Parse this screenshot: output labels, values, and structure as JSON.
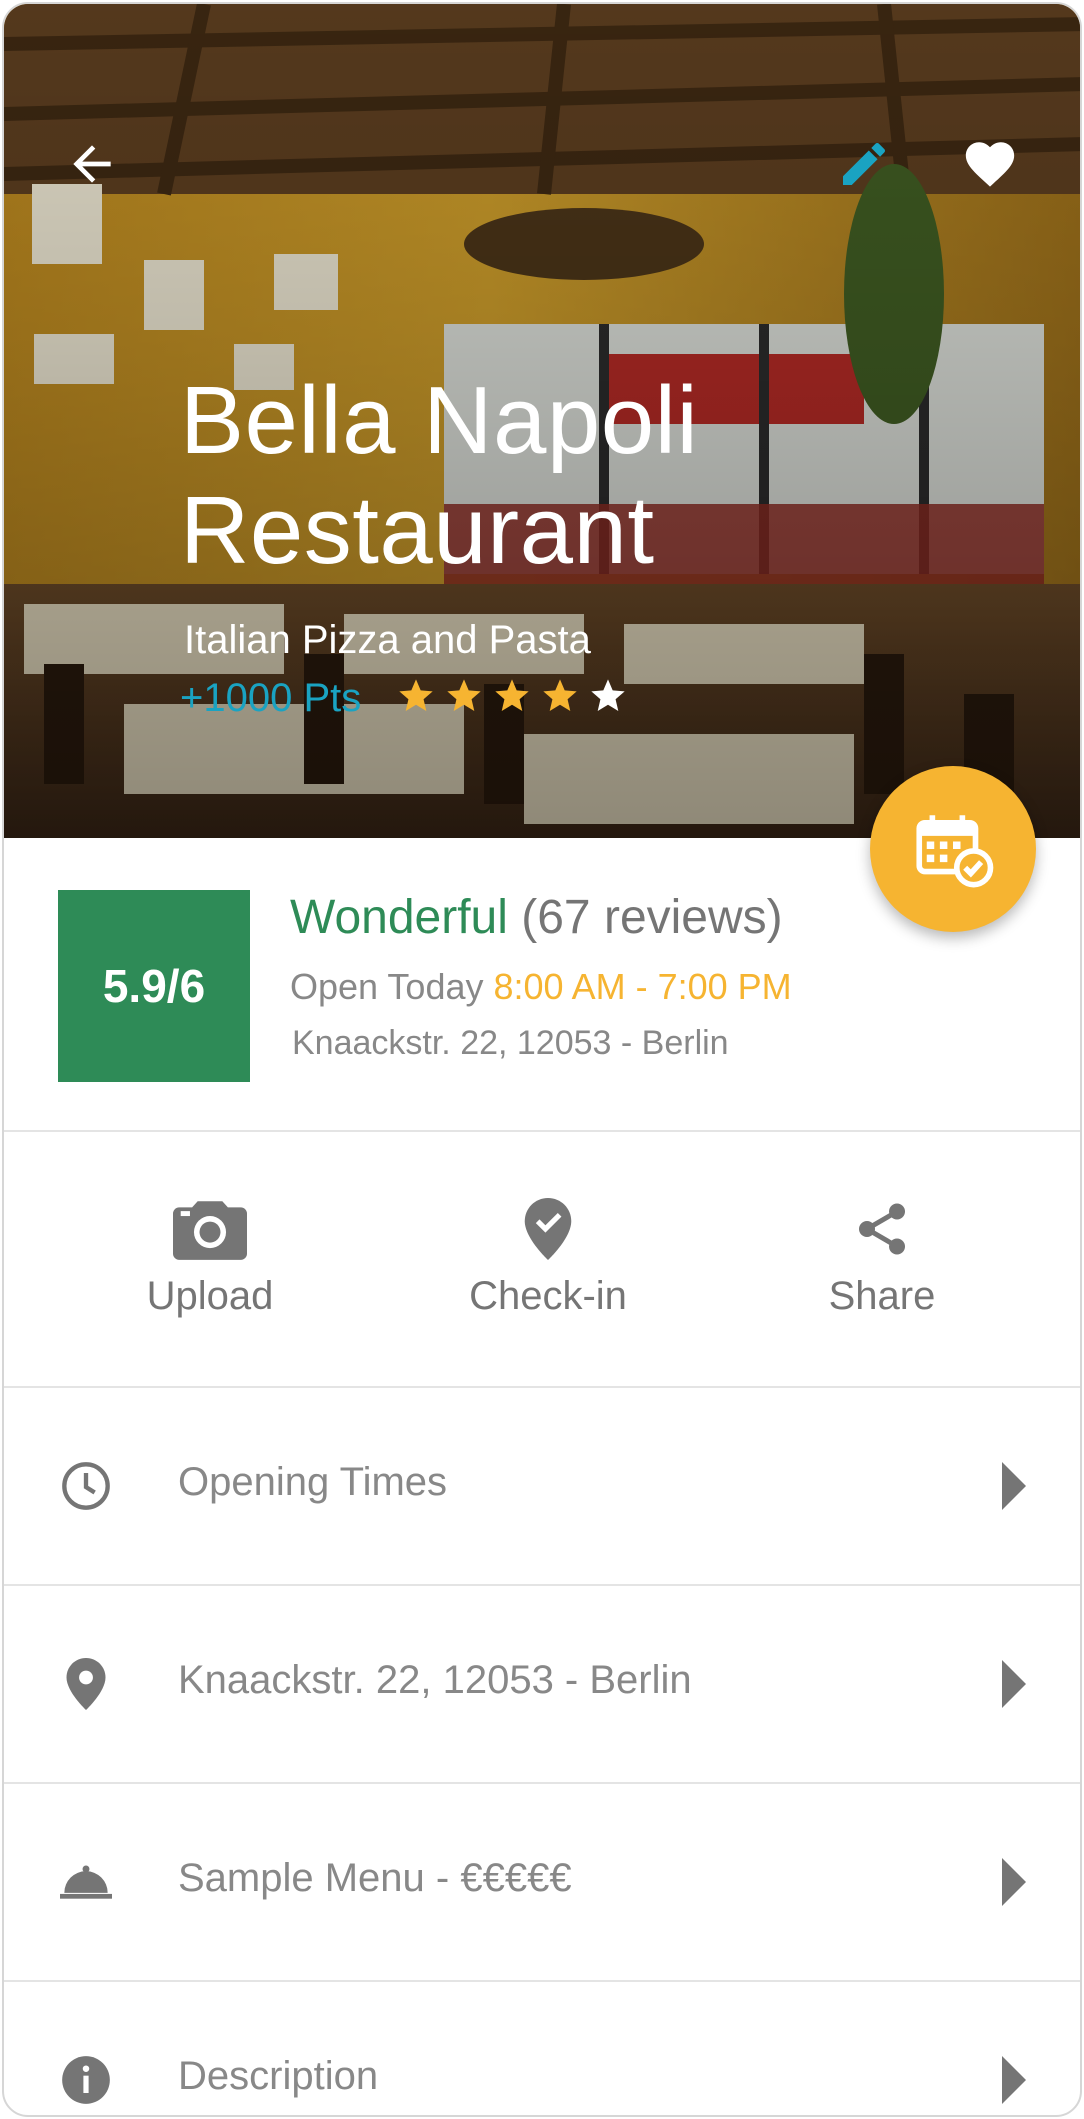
{
  "header": {
    "back_icon": "arrow-back-icon",
    "edit_icon": "pencil-icon",
    "favorite_icon": "heart-icon",
    "title_line1": "Bella Napoli",
    "title_line2": "Restaurant",
    "subtitle": "Italian Pizza and Pasta",
    "points": "+1000 Pts",
    "star_rating": 4,
    "star_max": 5,
    "colors": {
      "accent": "#1aa3c2",
      "star_filled": "#f6b431",
      "star_empty": "#ffffff"
    }
  },
  "fab": {
    "icon": "calendar-check-icon",
    "color": "#f6b431"
  },
  "summary": {
    "score": "5.9/6",
    "rating_word": "Wonderful",
    "reviews": "(67 reviews)",
    "open_label": "Open Today",
    "hours": "8:00 AM - 7:00 PM",
    "address": "Knaackstr. 22, 12053 - Berlin",
    "colors": {
      "score_bg": "#2e8b57",
      "hours": "#f6b431"
    }
  },
  "actions": [
    {
      "label": "Upload",
      "icon": "camera-icon"
    },
    {
      "label": "Check-in",
      "icon": "location-check-icon"
    },
    {
      "label": "Share",
      "icon": "share-icon"
    }
  ],
  "list": [
    {
      "label": "Opening Times",
      "icon": "clock-icon"
    },
    {
      "label": "Knaackstr. 22, 12053 - Berlin",
      "icon": "map-pin-icon"
    },
    {
      "label": "Sample Menu - €€€€€",
      "icon": "food-cloche-icon"
    },
    {
      "label": "Description",
      "icon": "info-icon"
    }
  ]
}
